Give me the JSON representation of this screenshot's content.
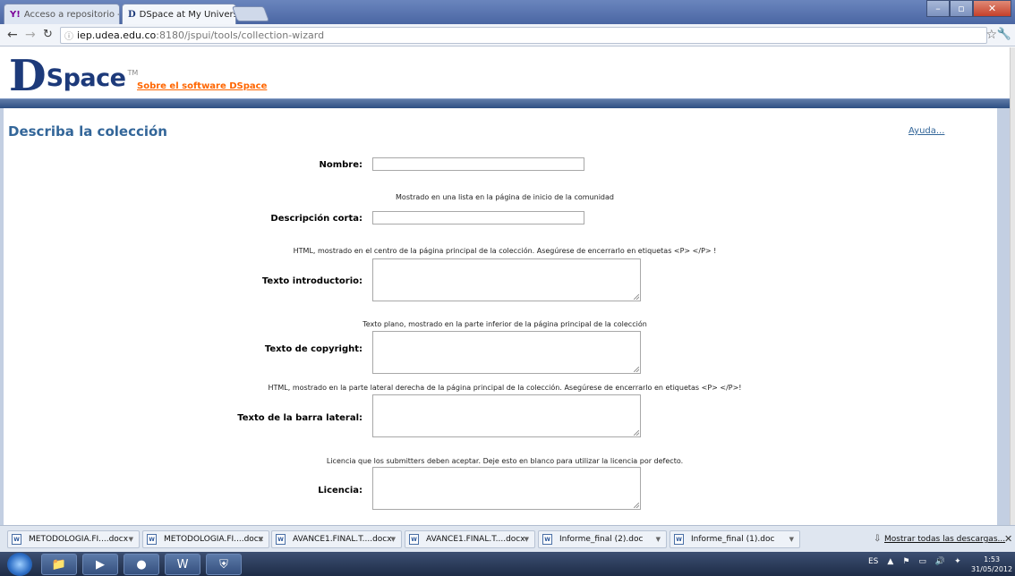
{
  "browser": {
    "tabs": [
      {
        "title": "Acceso a repositorio - Band",
        "icon": "yahoo-icon"
      },
      {
        "title": "DSpace at My University: De",
        "icon": "dspace-icon"
      }
    ],
    "url_domain": "iep.udea.edu.co",
    "url_rest": ":8180/jspui/tools/collection-wizard"
  },
  "header": {
    "logo_d": "D",
    "logo_space": "Space",
    "logo_tm": "TM",
    "about_link": "Sobre el software DSpace"
  },
  "main": {
    "title": "Describa la colección",
    "help_link": "Ayuda...",
    "fields": {
      "nombre_label": "Nombre:",
      "nombre_value": "",
      "short_hint": "Mostrado en una lista en la página de inicio de la comunidad",
      "short_label": "Descripción corta:",
      "short_value": "",
      "intro_hint": "HTML, mostrado en el centro de la página principal de la colección. Asegúrese de encerrarlo en etiquetas <P> </P> !",
      "intro_label": "Texto introductorio:",
      "copyright_hint": "Texto plano, mostrado en la parte inferior de la página principal de la colección",
      "copyright_label": "Texto de copyright:",
      "sidebar_hint": "HTML, mostrado en la parte lateral derecha de la página principal de la colección. Asegúrese de encerrarlo en etiquetas <P> </P>!",
      "sidebar_label": "Texto de la barra lateral:",
      "license_hint": "Licencia que los submitters deben aceptar. Deje esto en blanco para utilizar la licencia por defecto.",
      "license_label": "Licencia:"
    }
  },
  "downloads": {
    "items": [
      "METODOLOGIA.FI....docx",
      "METODOLOGIA.FI....docx",
      "AVANCE1.FINAL.T....docx",
      "AVANCE1.FINAL.T....docx",
      "Informe_final (2).doc",
      "Informe_final (1).doc"
    ],
    "show_all": "Mostrar todas las descargas..."
  },
  "taskbar": {
    "lang": "ES",
    "time": "1:53",
    "date": "31/05/2012"
  }
}
